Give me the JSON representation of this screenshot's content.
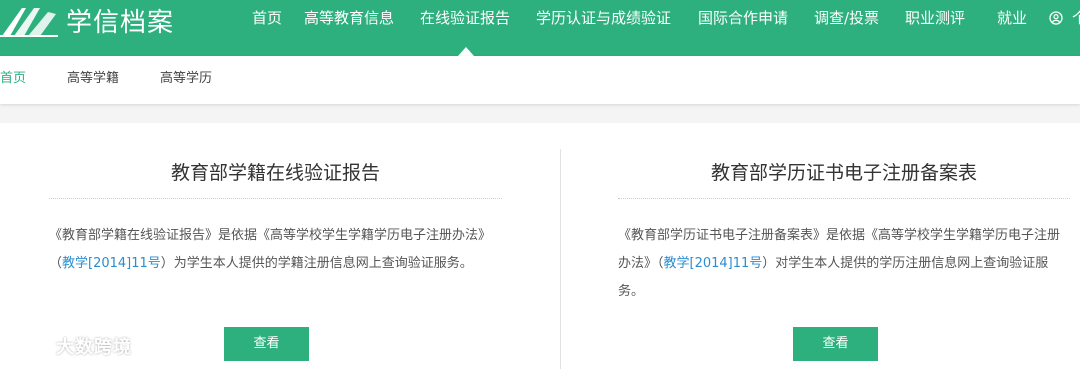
{
  "header": {
    "logo_text": "学信档案",
    "nav": [
      {
        "label": "首页"
      },
      {
        "label": "高等教育信息"
      },
      {
        "label": "在线验证报告"
      },
      {
        "label": "学历认证与成绩验证"
      },
      {
        "label": "国际合作申请"
      },
      {
        "label": "调查/投票"
      },
      {
        "label": "职业测评"
      },
      {
        "label": "就业"
      }
    ],
    "user_partial": "个",
    "active_nav": "在线验证报告",
    "brand_color": "#2db07e"
  },
  "subnav": {
    "items": [
      {
        "label": "首页"
      },
      {
        "label": "高等学籍"
      },
      {
        "label": "高等学历"
      }
    ],
    "active": "首页"
  },
  "cards": [
    {
      "title": "教育部学籍在线验证报告",
      "desc_before": "《教育部学籍在线验证报告》是依据《高等学校学生学籍学历电子注册办法》（",
      "desc_link": "教学[2014]11号",
      "desc_after": "）为学生本人提供的学籍注册信息网上查询验证服务。",
      "button": "查看"
    },
    {
      "title": "教育部学历证书电子注册备案表",
      "desc_before": "《教育部学历证书电子注册备案表》是依据《高等学校学生学籍学历电子注册办法》（",
      "desc_link": "教学[2014]11号",
      "desc_after": "）对学生本人提供的学历注册信息网上查询验证服务。",
      "button": "查看"
    }
  ],
  "watermark": {
    "text": "大数跨境"
  }
}
